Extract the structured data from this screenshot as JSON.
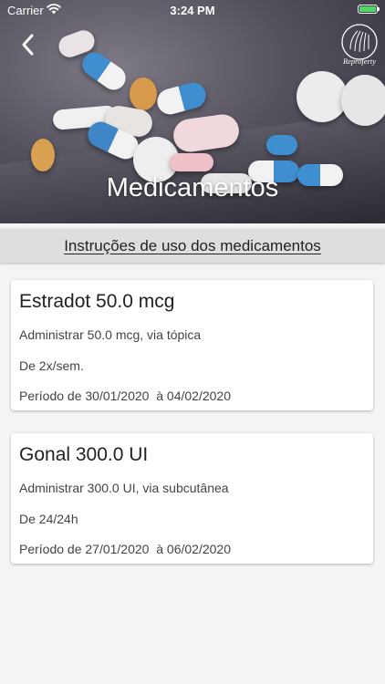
{
  "status_bar": {
    "carrier": "Carrier",
    "time": "3:24 PM"
  },
  "header": {
    "title": "Medicamentos",
    "logo_text": "Reproferty",
    "back_icon": "chevron-left-icon"
  },
  "instructions": {
    "label": "Instruções de uso dos medicamentos"
  },
  "medications": [
    {
      "title": "Estradot 50.0 mcg",
      "administration": "Administrar 50.0 mcg, via tópica",
      "frequency": "De 2x/sem.",
      "period": "Período de 30/01/2020  à 04/02/2020"
    },
    {
      "title": "Gonal 300.0 UI",
      "administration": "Administrar 300.0 UI, via subcutânea",
      "frequency": "De 24/24h",
      "period": "Período de 27/01/2020  à 06/02/2020"
    }
  ],
  "colors": {
    "background": "#f4f4f4",
    "card": "#ffffff",
    "instructions_bar": "#dedede",
    "battery": "#4cd964"
  }
}
